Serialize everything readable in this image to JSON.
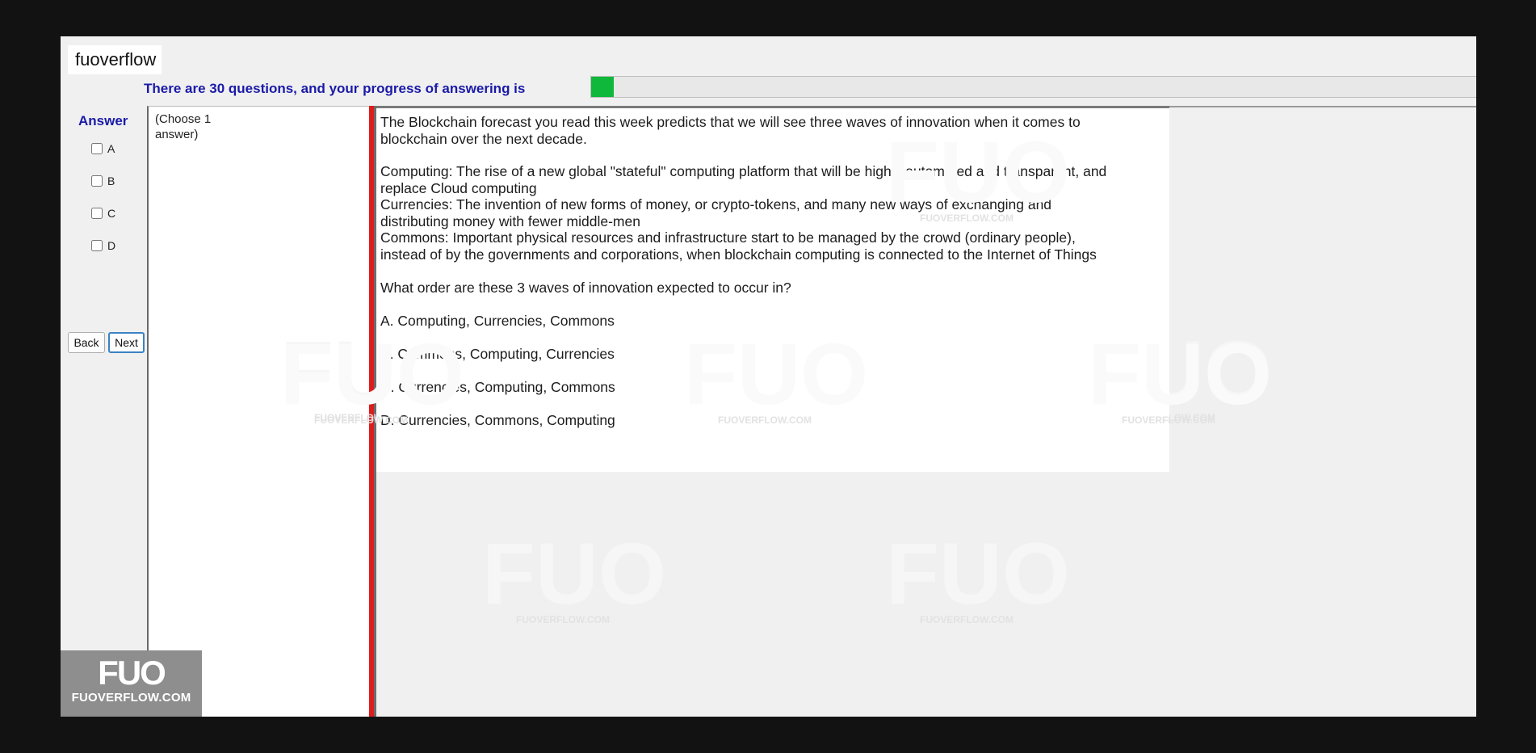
{
  "brand": {
    "tab_label": "fuoverflow"
  },
  "progress": {
    "text": "There are 30 questions, and your progress of answering is",
    "value_fraction": 0.025,
    "color": "#0fb83a"
  },
  "answer": {
    "title": "Answer",
    "options": [
      {
        "label": "A",
        "checked": false
      },
      {
        "label": "B",
        "checked": false
      },
      {
        "label": "C",
        "checked": false
      },
      {
        "label": "D",
        "checked": false
      }
    ]
  },
  "nav": {
    "back_label": "Back",
    "next_label": "Next"
  },
  "choose_hint": "(Choose 1 answer)",
  "question": {
    "lines": [
      "The Blockchain forecast you read this week predicts that we will see three waves of innovation when it comes to blockchain over the next decade.",
      "Computing: The rise of a new global \"stateful\" computing platform that will be highly automated and transparent, and replace Cloud computing",
      "Currencies: The invention of new forms of money, or crypto-tokens, and many new ways of exchanging and distributing money with fewer middle-men",
      "Commons: Important physical resources and infrastructure start to be managed by the crowd (ordinary people), instead of by the governments and corporations, when blockchain computing is connected to the Internet of Things",
      "What order are these 3 waves of innovation expected to occur in?"
    ],
    "choices": [
      "A.  Computing, Currencies, Commons",
      "B.  Commons, Computing, Currencies",
      "C.  Currencies, Computing, Commons",
      "D.  Currencies, Commons, Computing"
    ]
  },
  "watermark": {
    "mark": "FUO",
    "site": "FUOVERFLOW.COM"
  },
  "logo": {
    "mark": "FUO",
    "site": "FUOVERFLOW.COM"
  },
  "colors": {
    "accent_blue": "#1a1aa8",
    "splitter_red": "#dd1c1c",
    "background": "#121212"
  }
}
